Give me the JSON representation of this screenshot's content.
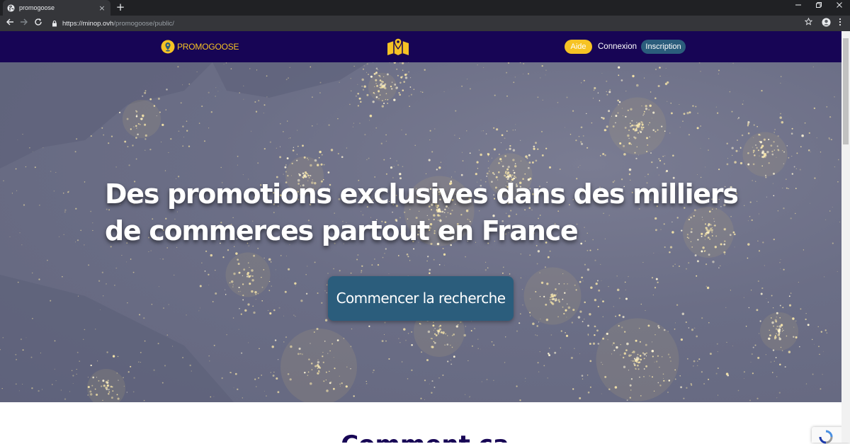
{
  "browser": {
    "tab_title": "promogoose",
    "tab_close_glyph": "×",
    "new_tab_glyph": "+",
    "url_host": "https://minop.ovh",
    "url_path": "/promogoose/public/",
    "icons": [
      "globe-icon",
      "back-arrow-icon",
      "forward-arrow-icon",
      "reload-icon",
      "lock-icon",
      "star-icon",
      "profile-icon",
      "kebab-menu-icon",
      "minimize-icon",
      "restore-icon",
      "close-icon"
    ]
  },
  "site": {
    "brand_name": "PROMOGOOSE",
    "nav": {
      "aide": "Aide",
      "connexion": "Connexion",
      "inscription": "Inscription"
    },
    "colors": {
      "header_bg": "#170555",
      "accent_yellow": "#f6c324",
      "button_blue": "#2b5d7c"
    }
  },
  "hero": {
    "title": "Des promotions exclusives dans des milliers de commerces partout en France",
    "cta": "Commencer la recherche"
  },
  "section": {
    "heading": "Comment ça marche ?"
  }
}
